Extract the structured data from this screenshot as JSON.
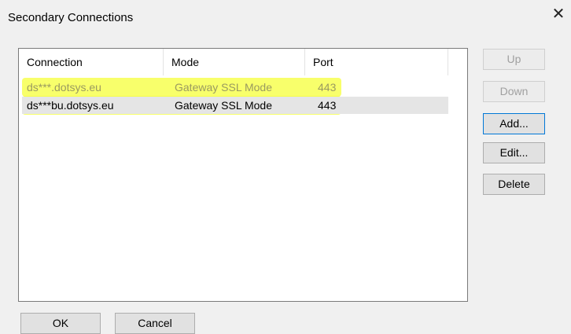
{
  "window": {
    "title": "Secondary Connections",
    "close_glyph": "✕"
  },
  "table": {
    "columns": [
      "Connection",
      "Mode",
      "Port"
    ],
    "rows": [
      {
        "connection": "ds***.dotsys.eu",
        "mode": "Gateway SSL Mode",
        "port": "443"
      },
      {
        "connection": "ds***bu.dotsys.eu",
        "mode": "Gateway SSL Mode",
        "port": "443"
      }
    ]
  },
  "buttons": {
    "up": "Up",
    "down": "Down",
    "add": "Add...",
    "edit": "Edit...",
    "delete": "Delete",
    "ok": "OK",
    "cancel": "Cancel"
  },
  "colors": {
    "highlight": "#f5ff3a",
    "disabled_text": "#a0a0a0",
    "focus_border": "#0078d7"
  }
}
